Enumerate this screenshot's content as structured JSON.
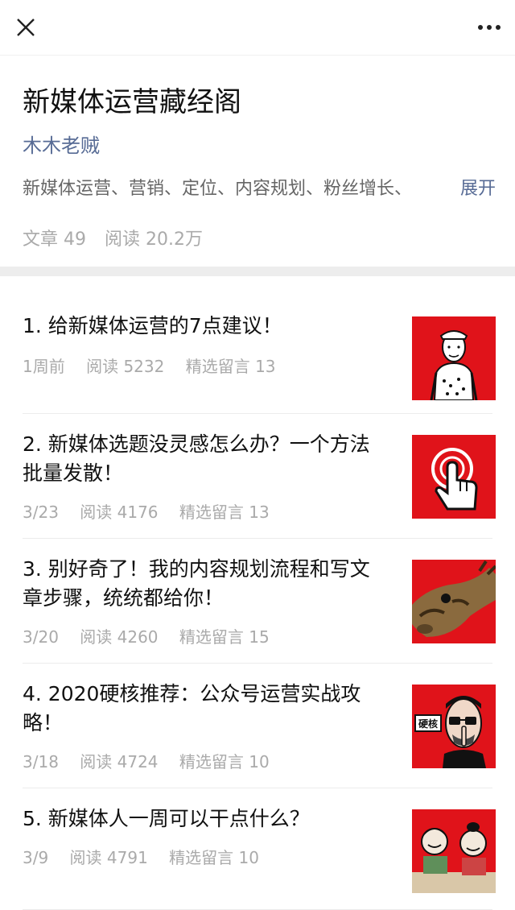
{
  "topbar": {
    "close_icon": "close-icon",
    "more_icon": "more-dots-icon"
  },
  "header": {
    "title": "新媒体运营藏经阁",
    "author": "木木老贼",
    "description": "新媒体运营、营销、定位、内容规划、粉丝增长、",
    "expand_label": "展开",
    "articles_stat": "文章 49",
    "reads_stat": "阅读 20.2万"
  },
  "articles": [
    {
      "title": "1. 给新媒体运营的7点建议！",
      "date": "1周前",
      "reads": "阅读 5232",
      "comments": "精选留言 13"
    },
    {
      "title": "2. 新媒体选题没灵感怎么办？一个方法批量发散！",
      "date": "3/23",
      "reads": "阅读 4176",
      "comments": "精选留言 13"
    },
    {
      "title": "3. 别好奇了！我的内容规划流程和写文章步骤，统统都给你！",
      "date": "3/20",
      "reads": "阅读 4260",
      "comments": "精选留言 15"
    },
    {
      "title": "4. 2020硬核推荐：公众号运营实战攻略！",
      "date": "3/18",
      "reads": "阅读 4724",
      "comments": "精选留言 10",
      "thumb_label": "硬核"
    },
    {
      "title": "5. 新媒体人一周可以干点什么？",
      "date": "3/9",
      "reads": "阅读 4791",
      "comments": "精选留言 10"
    }
  ],
  "colors": {
    "link_blue": "#576b95",
    "thumb_red": "#e0131a",
    "meta_gray": "#aaaaaa"
  }
}
